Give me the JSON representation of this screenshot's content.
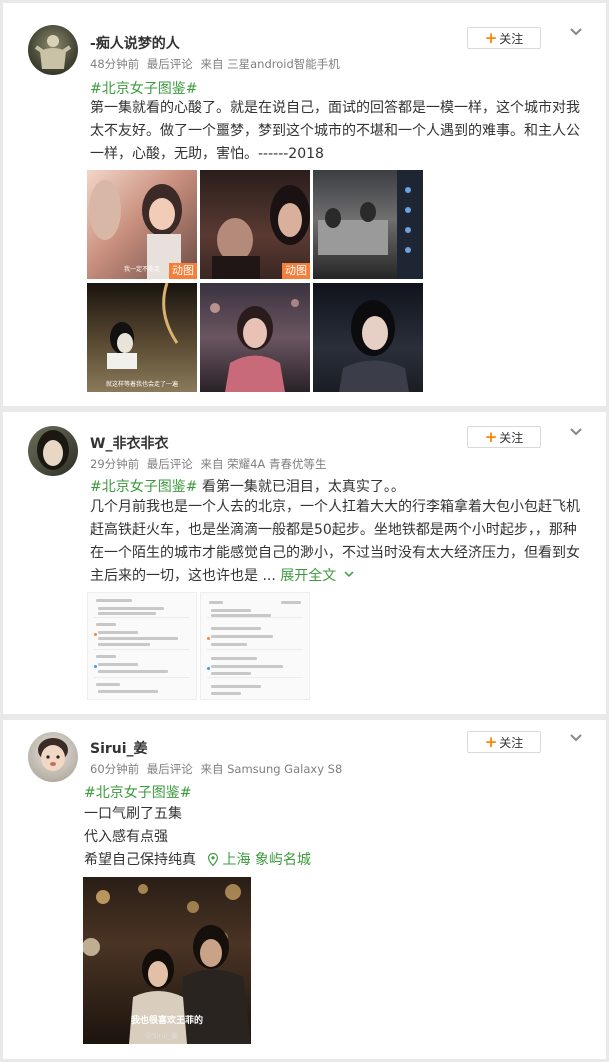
{
  "posts": [
    {
      "username": "-痴人说梦的人",
      "time": "48分钟前",
      "tag": "最后评论",
      "source": "来自 三星android智能手机",
      "follow_label": "关注",
      "hashtag": "#北京女子图鉴#",
      "lines": [
        "第一集就看的心酸了。就是在说自己，面试的回答都是一模一样，这个城市对我",
        "太不友好。做了一个噩梦，梦到这个城市的不堪和一个人遇到的难事。和主人公",
        "一样，心酸，无助，害怕。------2018"
      ],
      "images": [
        {
          "badge": "动图",
          "caption": "我一定不能走"
        },
        {
          "badge": "动图"
        },
        {},
        {
          "caption": "就这样等着我也会走了一遍"
        },
        {},
        {}
      ]
    },
    {
      "username": "W_非衣非衣",
      "time": "29分钟前",
      "tag": "最后评论",
      "source": "来自 荣耀4A 青春优等生",
      "follow_label": "关注",
      "hashtag": "#北京女子图鉴#",
      "hashtag_suffix": " 看第一集就已泪目，太真实了。。",
      "lines": [
        "几个月前我也是一个人去的北京，一个人扛着大大的行李箱拿着大包小包赶飞机",
        "赶高铁赶火车，也是坐滴滴一般都是50起步。坐地铁都是两个小时起步，，那种",
        "在一个陌生的城市才能感觉自己的渺小，不过当时没有太大经济压力，但看到女"
      ],
      "last_line": "主后来的一切，这也许也是 ...",
      "expand_label": "展开全文"
    },
    {
      "username": "Sirui_姜",
      "time": "60分钟前",
      "tag": "最后评论",
      "source": "来自 Samsung Galaxy S8",
      "follow_label": "关注",
      "hashtag": "#北京女子图鉴#",
      "lines": [
        "一口气刷了五集",
        "代入感有点强",
        "希望自己保持纯真"
      ],
      "location": "上海 象屿名城",
      "photo_caption": "我也很喜欢王菲的",
      "photo_watermark": "@Sirui_姜"
    }
  ],
  "icons": {
    "chevron": "chevron-down-icon",
    "location": "location-pin-icon",
    "plus": "plus-icon"
  },
  "colors": {
    "accent_orange": "#ff8200",
    "hashtag_green": "#3d9a3d",
    "meta_gray": "#808080",
    "badge_orange": "#f47e3a"
  }
}
